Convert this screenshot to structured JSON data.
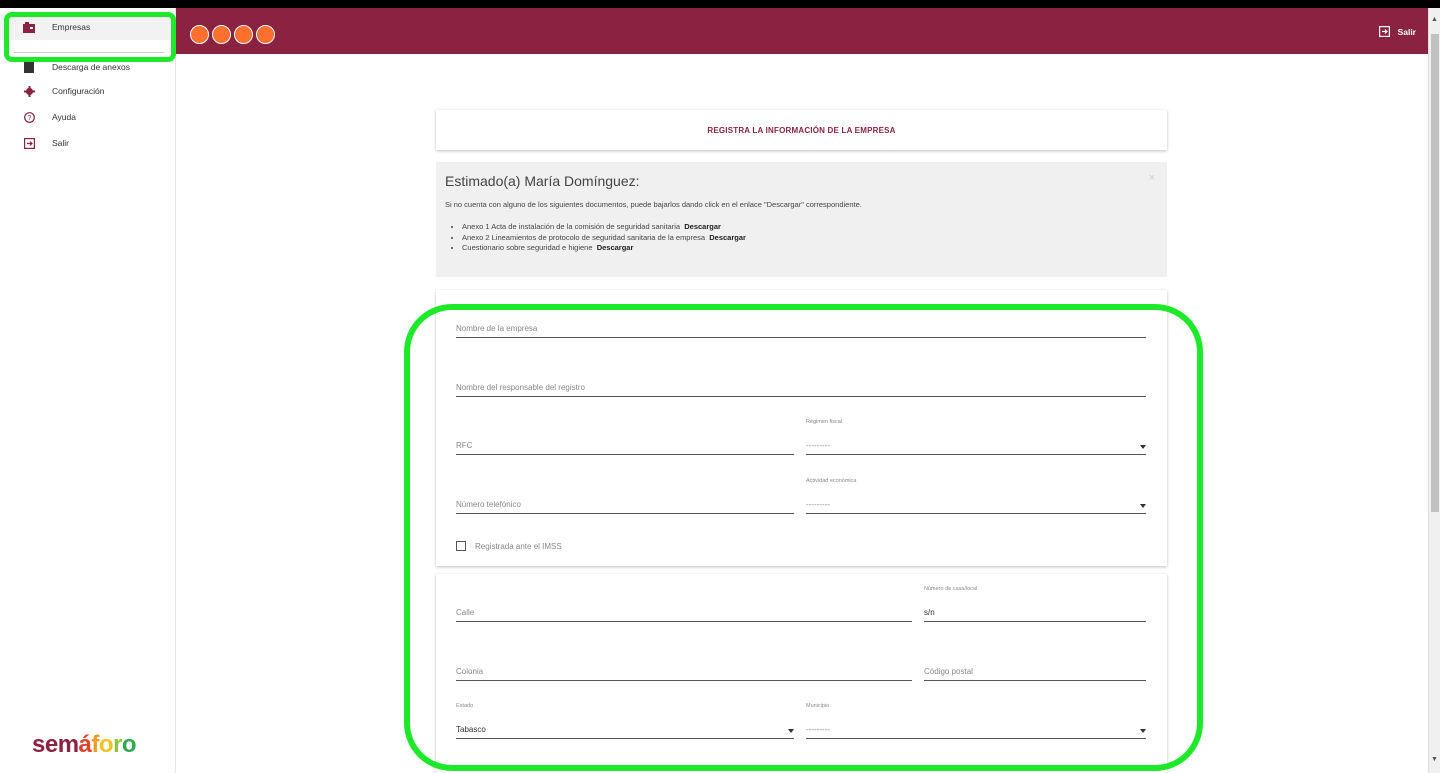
{
  "sidebar": {
    "items": [
      {
        "label": "Empresas",
        "icon": "briefcase-icon"
      },
      {
        "label": "Descarga de anexos",
        "icon": "download-icon"
      },
      {
        "label": "Configuración",
        "icon": "gear-icon"
      },
      {
        "label": "Ayuda",
        "icon": "help-icon"
      },
      {
        "label": "Salir",
        "icon": "exit-icon"
      }
    ],
    "logo": "semáforo"
  },
  "topbar": {
    "exit_label": "Salir",
    "dot_color": "#ff6f2e",
    "bar_color": "#8a2341"
  },
  "header": {
    "title": "REGISTRA LA INFORMACIÓN DE LA EMPRESA"
  },
  "alert": {
    "title": "Estimado(a) María Domínguez:",
    "close": "×",
    "text": "Si no cuenta con alguno de los siguientes documentos, puede bajarlos dando click en el enlace \"Descargar\" correspondiente.",
    "items": [
      {
        "text": "Anexo 1 Acta de instalación de la comisión de seguridad sanitaria",
        "link": "Descargar"
      },
      {
        "text": "Anexo 2 Lineamientos de protocolo de seguridad sanitaria de la empresa",
        "link": "Descargar"
      },
      {
        "text": "Cuestionario sobre seguridad e higiene",
        "link": "Descargar"
      }
    ]
  },
  "form": {
    "company_name_placeholder": "Nombre de la empresa",
    "responsible_placeholder": "Nombre del responsable del registro",
    "rfc_placeholder": "RFC",
    "regime_label": "Régimen fiscal",
    "regime_value": "---------",
    "phone_placeholder": "Número telefónico",
    "activity_label": "Actividad económica",
    "activity_value": "---------",
    "imss_label": "Registrada ante el IMSS",
    "street_placeholder": "Calle",
    "house_number_label": "Número de casa/local",
    "house_number_value": "s/n",
    "colony_placeholder": "Colonia",
    "postal_code_placeholder": "Código postal",
    "state_label": "Estado",
    "state_value": "Tabasco",
    "municipality_label": "Municipio",
    "municipality_value": "---------"
  }
}
